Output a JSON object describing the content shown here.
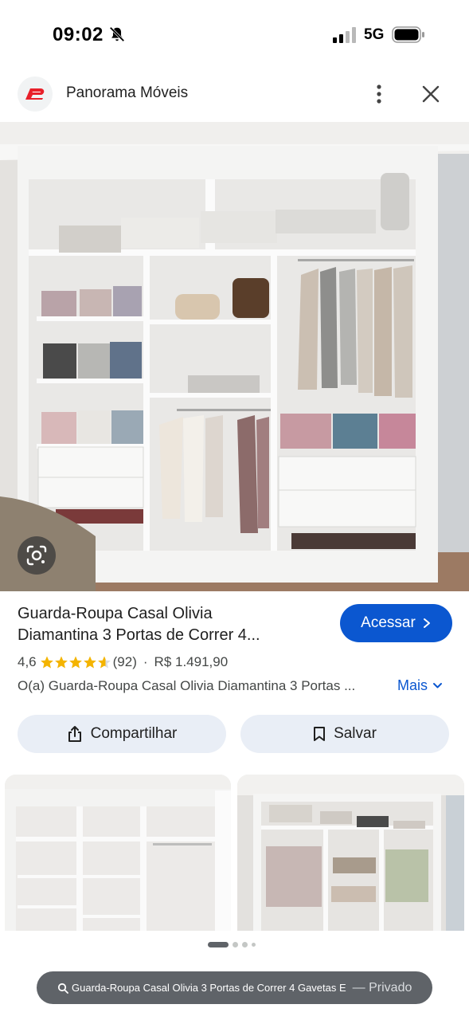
{
  "status_bar": {
    "time": "09:02",
    "network": "5G",
    "icons": [
      "bell-off-icon",
      "signal-icon",
      "battery-icon"
    ]
  },
  "source": {
    "name": "Panorama Móveis",
    "logo_icon": "panorama-logo",
    "brand_color": "#e8202a"
  },
  "product": {
    "title_line1": "Guarda-Roupa Casal Olivia",
    "title_line2": "Diamantina 3 Portas de Correr 4...",
    "visit_label": "Acessar",
    "rating": "4,6",
    "stars": 4.6,
    "review_count": "(92)",
    "separator": "·",
    "price": "R$ 1.491,90",
    "description": "O(a) Guarda-Roupa Casal Olivia Diamantina 3 Portas ...",
    "more_label": "Mais",
    "share_label": "Compartilhar",
    "save_label": "Salvar"
  },
  "pager": {
    "active_index": 0,
    "count": 4
  },
  "bottom_bar": {
    "url": "Guarda-Roupa Casal Olivia 3 Portas de Correr 4 Gavetas E",
    "private_label": "— Privado"
  },
  "colors": {
    "accent": "#0b57d0",
    "star": "#f4b400",
    "pill_bg": "#e9eef6"
  }
}
